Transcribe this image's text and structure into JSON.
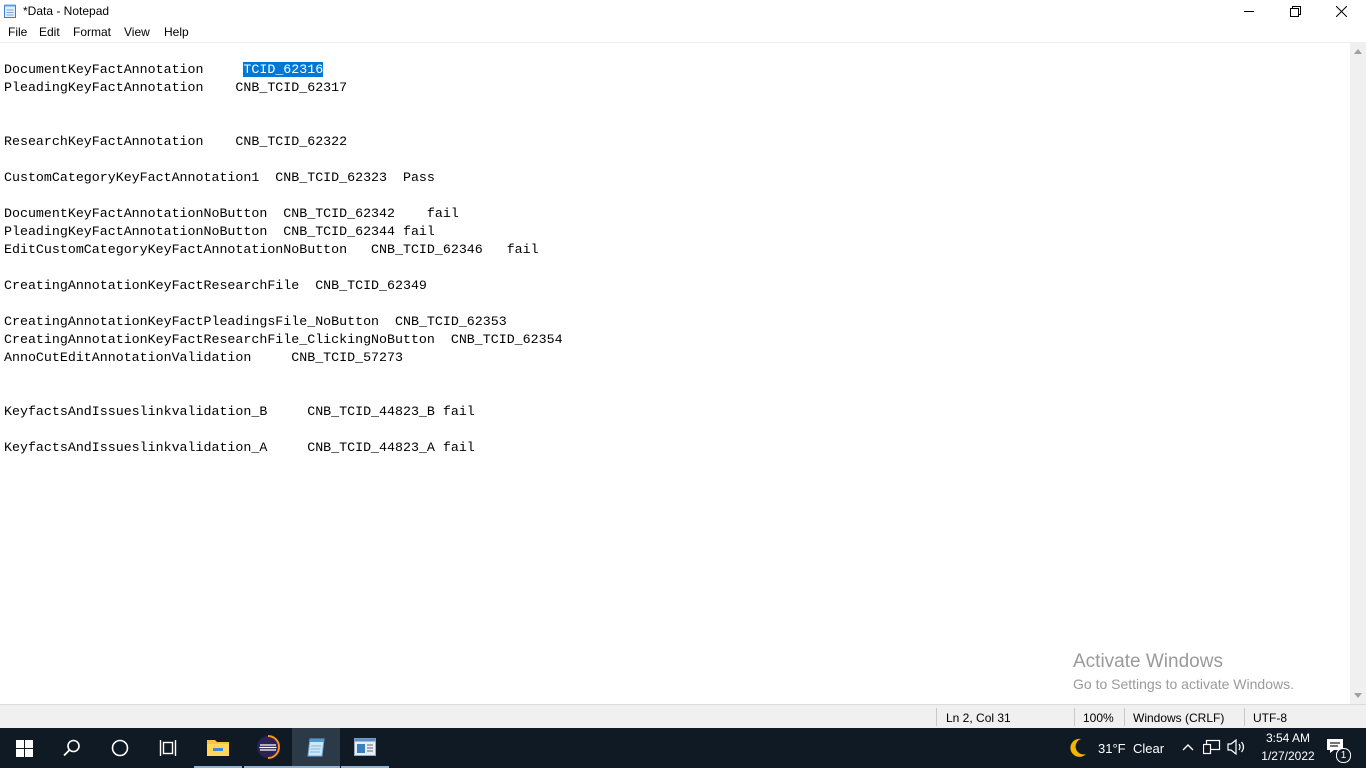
{
  "window": {
    "title": "*Data - Notepad",
    "icon": "notepad-icon",
    "controls": [
      "minimize-icon",
      "maximize-icon",
      "close-icon"
    ]
  },
  "menu": [
    "File",
    "Edit",
    "Format",
    "View",
    "Help"
  ],
  "editor": {
    "lines": [
      {
        "before": "DocumentKeyFactAnnotation     ",
        "selected": "TCID_62316",
        "after": ""
      },
      {
        "text": "PleadingKeyFactAnnotation    CNB_TCID_62317"
      },
      {
        "text": "ResearchKeyFactAnnotation    CNB_TCID_62322"
      },
      {
        "text": "CustomCategoryKeyFactAnnotation1  CNB_TCID_62323  Pass"
      },
      {
        "text": "DocumentKeyFactAnnotationNoButton  CNB_TCID_62342    fail"
      },
      {
        "text": "PleadingKeyFactAnnotationNoButton  CNB_TCID_62344 fail"
      },
      {
        "text": "EditCustomCategoryKeyFactAnnotationNoButton   CNB_TCID_62346   fail"
      },
      {
        "text": "CreatingAnnotationKeyFactResearchFile  CNB_TCID_62349"
      },
      {
        "text": "CreatingAnnotationKeyFactPleadingsFile_NoButton  CNB_TCID_62353"
      },
      {
        "text": "CreatingAnnotationKeyFactResearchFile_ClickingNoButton  CNB_TCID_62354"
      },
      {
        "text": "AnnoCutEditAnnotationValidation     CNB_TCID_57273"
      },
      {
        "text": "KeyfactsAndIssueslinkvalidation_B     CNB_TCID_44823_B fail"
      },
      {
        "text": "KeyfactsAndIssueslinkvalidation_A     CNB_TCID_44823_A fail"
      }
    ]
  },
  "watermark": {
    "line1": "Activate Windows",
    "line2": "Go to Settings to activate Windows."
  },
  "status": {
    "position": "Ln 2, Col 31",
    "zoom": "100%",
    "line_ending": "Windows (CRLF)",
    "encoding": "UTF-8"
  },
  "taskbar": {
    "apps": [
      "start-icon",
      "search-icon",
      "cortana-icon",
      "task-view-icon",
      "file-explorer-icon",
      "eclipse-icon",
      "notepad-icon",
      "app-window-icon"
    ],
    "weather": {
      "temp": "31°F",
      "condition": "Clear",
      "icon": "moon-icon"
    },
    "time": "3:54 AM",
    "date": "1/27/2022",
    "notification_count": "1"
  },
  "colors": {
    "selection": "#0078d7",
    "taskbar": "#101a24"
  }
}
